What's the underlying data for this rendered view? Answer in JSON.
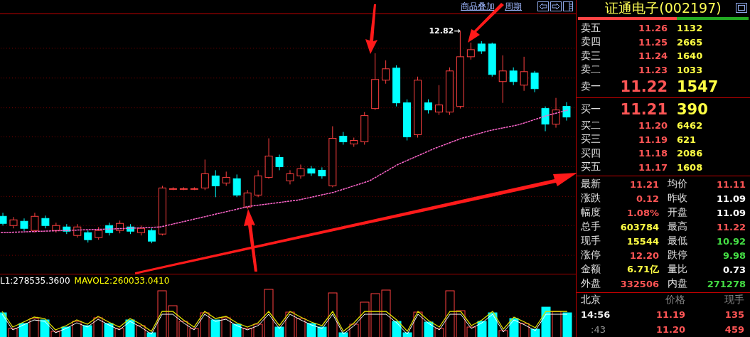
{
  "toolbar": {
    "links": [
      "商品叠加",
      "周期"
    ]
  },
  "price_chart": {
    "high_label": "12.82→"
  },
  "volume_chart": {
    "indicators": [
      {
        "label": "L1:278535.3600",
        "color": "#ffffff"
      },
      {
        "label": "MAVOL2:260033.0410",
        "color": "#ffff00"
      }
    ]
  },
  "quote": {
    "title": "证通电子(002197)",
    "ratio_bar": {
      "level": 0.58
    },
    "asks": [
      {
        "label": "卖五",
        "price": "11.26",
        "volume": "1132",
        "kind": "normal"
      },
      {
        "label": "卖四",
        "price": "11.25",
        "volume": "2665",
        "kind": "normal"
      },
      {
        "label": "卖三",
        "price": "11.24",
        "volume": "1640",
        "kind": "normal"
      },
      {
        "label": "卖二",
        "price": "11.23",
        "volume": "1033",
        "kind": "normal"
      },
      {
        "label": "卖一",
        "price": "11.22",
        "volume": "1547",
        "kind": "best"
      }
    ],
    "bids": [
      {
        "label": "买一",
        "price": "11.21",
        "volume": "390",
        "kind": "best"
      },
      {
        "label": "买二",
        "price": "11.20",
        "volume": "6462",
        "kind": "normal"
      },
      {
        "label": "买三",
        "price": "11.19",
        "volume": "621",
        "kind": "normal"
      },
      {
        "label": "买四",
        "price": "11.18",
        "volume": "2086",
        "kind": "normal"
      },
      {
        "label": "买五",
        "price": "11.17",
        "volume": "1608",
        "kind": "normal"
      }
    ],
    "stats": [
      {
        "label": "最新",
        "value": "11.21",
        "color": "#ff5555"
      },
      {
        "label": "均价",
        "value": "11.11",
        "color": "#ff5555"
      },
      {
        "label": "涨跌",
        "value": "0.12",
        "color": "#ff5555"
      },
      {
        "label": "昨收",
        "value": "11.09",
        "color": "#ffffff"
      },
      {
        "label": "幅度",
        "value": "1.08%",
        "color": "#ff5555"
      },
      {
        "label": "开盘",
        "value": "11.09",
        "color": "#ffffff"
      },
      {
        "label": "总手",
        "value": "603784",
        "color": "#ffff44"
      },
      {
        "label": "最高",
        "value": "11.22",
        "color": "#ff5555"
      },
      {
        "label": "现手",
        "value": "15544",
        "color": "#ffff44"
      },
      {
        "label": "最低",
        "value": "10.92",
        "color": "#44dd44"
      },
      {
        "label": "涨停",
        "value": "12.20",
        "color": "#ff5555"
      },
      {
        "label": "跌停",
        "value": "9.98",
        "color": "#44dd44"
      },
      {
        "label": "金额",
        "value": "6.71亿",
        "color": "#ffff44"
      },
      {
        "label": "量比",
        "value": "0.73",
        "color": "#ffffff"
      },
      {
        "label": "外盘",
        "value": "332506",
        "color": "#ff5555"
      },
      {
        "label": "内盘",
        "value": "271278",
        "color": "#44dd44"
      }
    ],
    "trades": {
      "columns": [
        "北京",
        "价格",
        "现手"
      ],
      "rows": [
        {
          "time": "14:56",
          "price": "11.19",
          "volume": "135"
        },
        {
          "time": ":43",
          "price": "11.20",
          "volume": "459"
        }
      ]
    }
  }
}
